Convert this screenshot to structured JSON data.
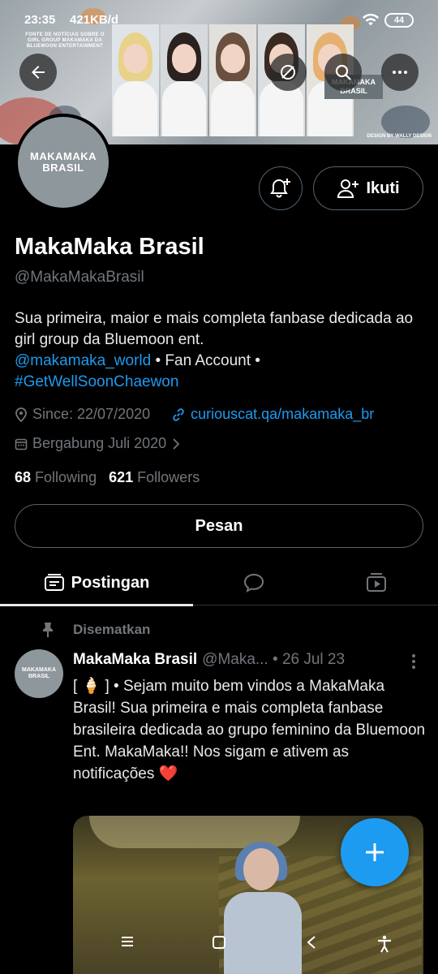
{
  "status_bar": {
    "time": "23:35",
    "speed": "421KB/d",
    "battery": "44"
  },
  "banner": {
    "caption": "FONTE DE NOTÍCIAS SOBRE O GIRL GROUP MAKAMAKA DA BLUEMOON ENTERTAINMENT",
    "logo_line1": "MAKAMAKA",
    "logo_line2": "BRASIL",
    "design_credit": "DESIGN BY WALLY DESIGN"
  },
  "header_buttons": {
    "back": "arrow-left-icon",
    "hide": "hide-icon",
    "search": "search-icon",
    "more": "more-icon"
  },
  "profile": {
    "avatar_line1": "MAKAMAKA",
    "avatar_line2": "BRASIL",
    "follow_label": "Ikuti",
    "name": "MakaMaka Brasil",
    "handle": "@MakaMakaBrasil",
    "bio_line": "Sua primeira, maior e mais completa fanbase dedicada ao girl group da Bluemoon ent.",
    "bio_mention": "@makamaka_world",
    "bio_mid": " • Fan Account • ",
    "bio_hashtag": "#GetWellSoonChaewon",
    "location": "Since: 22/07/2020",
    "website": "curiouscat.qa/makamaka_br",
    "joined": "Bergabung Juli 2020",
    "following_count": "68",
    "following_label": "Following",
    "followers_count": "621",
    "followers_label": "Followers",
    "message_label": "Pesan"
  },
  "tabs": {
    "posts_label": "Postingan"
  },
  "post": {
    "pinned_label": "Disematkan",
    "avatar_line1": "MAKAMAKA",
    "avatar_line2": "BRASIL",
    "author_name": "MakaMaka Brasil",
    "author_handle_date": "@Maka... • 26 Jul 23",
    "text": "[ 🍦 ] • Sejam muito bem vindos a MakaMaka Brasil! Sua primeira e mais completa fanbase brasileira dedicada ao grupo feminino da Bluemoon Ent. MakaMaka!! Nos sigam e ativem as notificações ❤️"
  },
  "colors": {
    "accent": "#1d9bf0",
    "background": "#000000",
    "muted": "#71767b",
    "border": "#536471"
  }
}
